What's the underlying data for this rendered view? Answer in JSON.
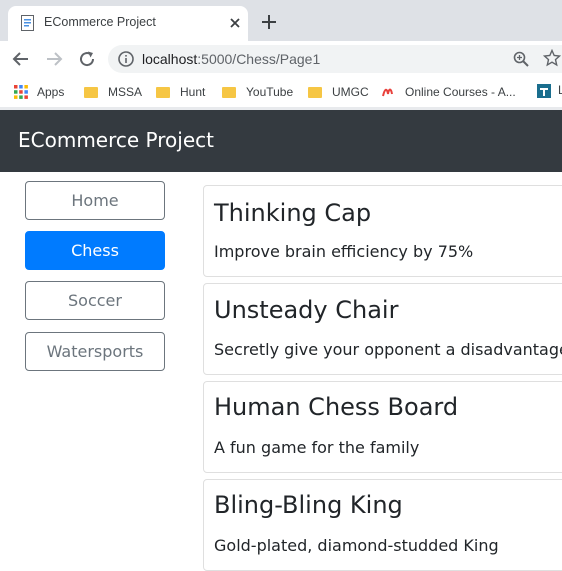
{
  "browser": {
    "tab_title": "ECommerce Project",
    "url_host": "localhost",
    "url_path": ":5000/Chess/Page1",
    "bookmarks": [
      {
        "label": "Apps",
        "icon": "apps-grid-icon"
      },
      {
        "label": "MSSA",
        "icon": "folder-icon"
      },
      {
        "label": "Hunt",
        "icon": "folder-icon"
      },
      {
        "label": "YouTube",
        "icon": "folder-icon"
      },
      {
        "label": "UMGC",
        "icon": "folder-icon"
      },
      {
        "label": "Online Courses - A...",
        "icon": "site-logo-icon"
      }
    ]
  },
  "navbar": {
    "brand": "ECommerce Project",
    "background": "#343a40"
  },
  "sidebar": {
    "items": [
      {
        "label": "Home",
        "active": false
      },
      {
        "label": "Chess",
        "active": true
      },
      {
        "label": "Soccer",
        "active": false
      },
      {
        "label": "Watersports",
        "active": false
      }
    ],
    "active_color": "#007bff"
  },
  "products": [
    {
      "name": "Thinking Cap",
      "description": "Improve brain efficiency by 75%"
    },
    {
      "name": "Unsteady Chair",
      "description": "Secretly give your opponent a disadvantage"
    },
    {
      "name": "Human Chess Board",
      "description": "A fun game for the family"
    },
    {
      "name": "Bling-Bling King",
      "description": "Gold-plated, diamond-studded King"
    }
  ]
}
